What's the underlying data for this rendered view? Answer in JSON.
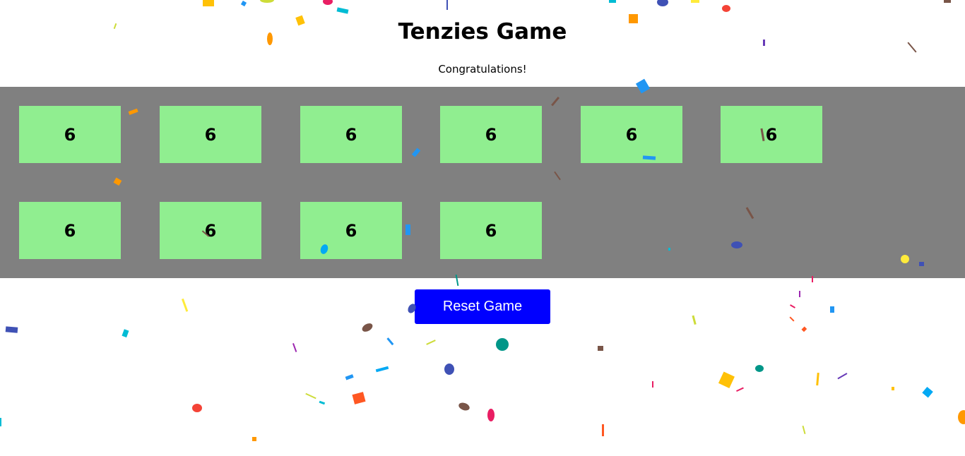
{
  "header": {
    "title": "Tenzies Game",
    "status": "Congratulations!"
  },
  "dice": [
    {
      "value": "6",
      "held": true
    },
    {
      "value": "6",
      "held": true
    },
    {
      "value": "6",
      "held": true
    },
    {
      "value": "6",
      "held": true
    },
    {
      "value": "6",
      "held": true
    },
    {
      "value": "6",
      "held": true
    },
    {
      "value": "6",
      "held": true
    },
    {
      "value": "6",
      "held": true
    },
    {
      "value": "6",
      "held": true
    },
    {
      "value": "6",
      "held": true
    }
  ],
  "controls": {
    "reset_label": "Reset Game"
  },
  "colors": {
    "board": "#808080",
    "held_die": "#90ee90",
    "button": "#0000ff"
  }
}
